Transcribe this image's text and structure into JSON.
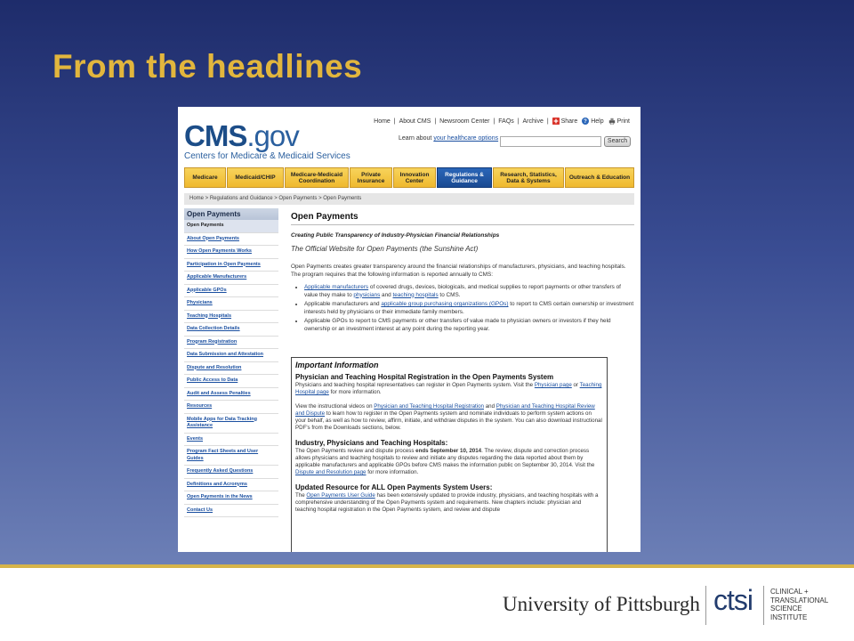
{
  "slide": {
    "title": "From the headlines",
    "colors": {
      "background_top": "#1e2c6b",
      "background_bottom": "#6c7fb6",
      "title": "#e2b63d",
      "divider": "#d6b44a"
    }
  },
  "cms": {
    "logo_main": "CMS",
    "logo_gov": ".gov",
    "logo_sub": "Centers for Medicare & Medicaid Services",
    "top_links": {
      "home": "Home",
      "sep1": "|",
      "about": "About CMS",
      "sep2": "|",
      "newsroom": "Newsroom Center",
      "sep3": "|",
      "faqs": "FAQs",
      "sep4": "|",
      "archive": "Archive",
      "sep5": "|",
      "share": "Share",
      "help": "Help",
      "print": "Print"
    },
    "learn_prefix": "Learn about",
    "learn_link": "your healthcare options",
    "search_placeholder": "",
    "search_button": "Search",
    "nav": [
      "Medicare",
      "Medicaid/CHIP",
      "Medicare-Medicaid Coordination",
      "Private Insurance",
      "Innovation Center",
      "Regulations & Guidance",
      "Research, Statistics, Data & Systems",
      "Outreach & Education"
    ],
    "breadcrumb": "Home  >  Regulations and Guidance  >  Open Payments  >  Open Payments",
    "sidebar": {
      "heading": "Open Payments",
      "items": [
        "Open Payments",
        "About Open Payments",
        "How Open Payments Works",
        "Participation in Open Payments",
        "Applicable Manufacturers",
        "Applicable GPOs",
        "Physicians",
        "Teaching Hospitals",
        "Data Collection Details",
        "Program Registration",
        "Data Submission and Attestation",
        "Dispute and Resolution",
        "Public Access to Data",
        "Audit and Assess Penalties",
        "Resources",
        "Mobile Apps for Data Tracking Assistance",
        "Events",
        "Program Fact Sheets and User Guides",
        "Frequently Asked Questions",
        "Definitions and Acronyms",
        "Open Payments in the News",
        "Contact Us"
      ]
    },
    "content": {
      "title": "Open Payments",
      "subtitle": "Creating Public Transparency of Industry-Physician Financial Relationships",
      "official": "The Official Website for Open Payments (the Sunshine Act)",
      "intro": "Open Payments creates greater transparency around the financial relationships of manufacturers, physicians, and teaching hospitals. The program requires that the following information is reported annually to CMS:",
      "b1_link": "Applicable manufacturers",
      "b1_text": " of covered drugs, devices, biologicals, and medical supplies to report payments or other transfers of value they make to ",
      "b1_link2": "physicians",
      "b1_and": " and ",
      "b1_link3": "teaching hospitals",
      "b1_end": " to CMS.",
      "b2_text": "Applicable manufacturers and ",
      "b2_link": "applicable group purchasing organizations (GPOs)",
      "b2_end": " to report to CMS certain ownership or investment interests held by physicians or their immediate family members.",
      "b3_text": "Applicable GPOs to report to CMS payments or other transfers of value made to physician owners or investors if they held ownership or an investment interest at any point during the reporting year."
    },
    "info": {
      "heading": "Important Information",
      "h1": "Physician and Teaching Hospital Registration in the Open Payments System",
      "p1a": "Physicians and teaching hospital representatives can register in Open Payments system. Visit the ",
      "p1_link1": "Physician page",
      "p1_or": " or ",
      "p1_link2": "Teaching Hospital page",
      "p1_end": " for more information.",
      "p2a": "View the instructional videos on ",
      "p2_link1": "Physician and Teaching Hospital Registration",
      "p2_and": " and ",
      "p2_link2": "Physician and Teaching Hospital Review and Dispute",
      "p2_end": " to learn how to register in the Open Payments system and nominate individuals to perform system actions on your behalf, as well as how to review, affirm, initiate, and withdraw disputes in the system. You can also download instructional PDF's from the Downloads sections, below.",
      "h2": "Industry, Physicians and Teaching Hospitals:",
      "p3a": "The Open Payments review and dispute process ",
      "p3_bold": "ends September 10, 2014",
      "p3b": ". The review, dispute and correction process allows physicians and teaching hospitals to review and initiate any disputes regarding the data reported about them by applicable manufacturers and applicable GPOs before CMS makes the information public on September 30, 2014. Visit the ",
      "p3_link": "Dispute and Resolution page",
      "p3_end": " for more information.",
      "h3": "Updated Resource for ALL Open Payments System Users:",
      "p4a": "The ",
      "p4_link": "Open Payments User Guide",
      "p4_end": " has been extensively updated to provide industry, physicians, and teaching hospitals with a comprehensive understanding of the Open Payments system and requirements. New chapters include: physician and teaching hospital registration in the Open Payments system, and review and dispute"
    }
  },
  "footer": {
    "university": "University of Pittsburgh",
    "ctsi": "ctsi",
    "ctsi_lines": [
      "CLINICAL +",
      "TRANSLATIONAL",
      "SCIENCE",
      "INSTITUTE"
    ]
  }
}
